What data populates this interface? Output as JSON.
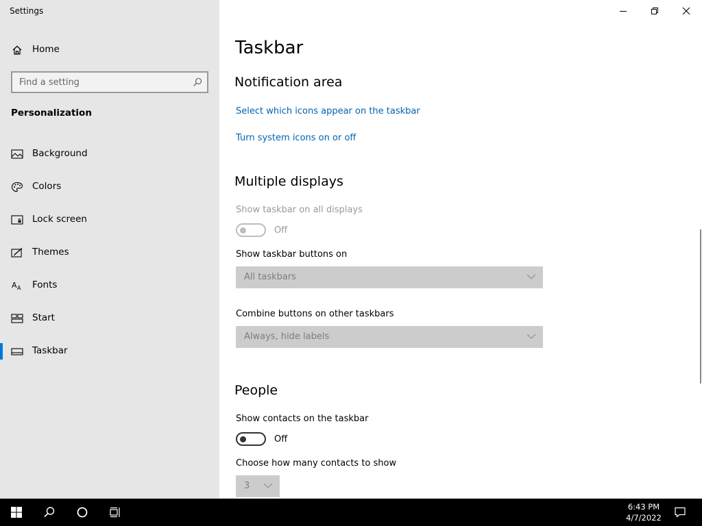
{
  "window": {
    "title": "Settings"
  },
  "sidebar": {
    "home_label": "Home",
    "search_placeholder": "Find a setting",
    "section_title": "Personalization",
    "items": [
      {
        "label": "Background",
        "icon": "picture-icon"
      },
      {
        "label": "Colors",
        "icon": "palette-icon"
      },
      {
        "label": "Lock screen",
        "icon": "lock-screen-icon"
      },
      {
        "label": "Themes",
        "icon": "themes-icon"
      },
      {
        "label": "Fonts",
        "icon": "fonts-icon"
      },
      {
        "label": "Start",
        "icon": "start-icon"
      },
      {
        "label": "Taskbar",
        "icon": "taskbar-icon",
        "selected": true
      }
    ]
  },
  "main": {
    "page_title": "Taskbar",
    "notification_area": {
      "heading": "Notification area",
      "link_icons": "Select which icons appear on the taskbar",
      "link_system_icons": "Turn system icons on or off"
    },
    "multiple_displays": {
      "heading": "Multiple displays",
      "show_on_all_label": "Show taskbar on all displays",
      "show_on_all_state": "Off",
      "buttons_on_label": "Show taskbar buttons on",
      "buttons_on_value": "All taskbars",
      "combine_label": "Combine buttons on other taskbars",
      "combine_value": "Always, hide labels"
    },
    "people": {
      "heading": "People",
      "show_contacts_label": "Show contacts on the taskbar",
      "show_contacts_state": "Off",
      "how_many_label": "Choose how many contacts to show",
      "how_many_value": "3"
    }
  },
  "taskbar": {
    "time": "6:43 PM",
    "date": "4/7/2022"
  },
  "colors": {
    "accent": "#0078d7",
    "link": "#0063b1",
    "sidebar_bg": "#e6e6e6",
    "taskbar_bg": "#000000"
  }
}
